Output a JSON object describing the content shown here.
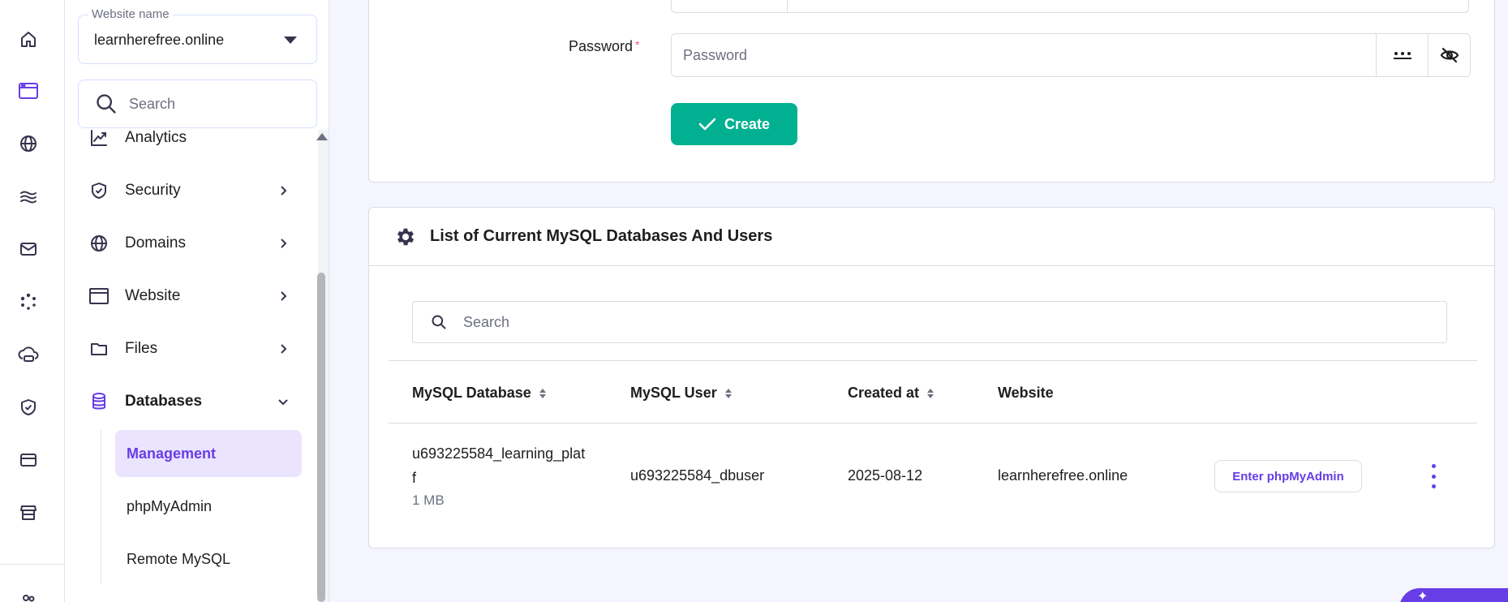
{
  "sidebar": {
    "website_select": {
      "legend": "Website name",
      "value": "learnherefree.online"
    },
    "search": {
      "placeholder": "Search"
    },
    "items": [
      {
        "label": "Analytics",
        "icon": "chart-icon"
      },
      {
        "label": "Security",
        "icon": "shield-icon"
      },
      {
        "label": "Domains",
        "icon": "globe-icon"
      },
      {
        "label": "Website",
        "icon": "browser-window-icon"
      },
      {
        "label": "Files",
        "icon": "folder-icon"
      },
      {
        "label": "Databases",
        "icon": "database-icon"
      }
    ],
    "database_subitems": [
      {
        "label": "Management",
        "active": true
      },
      {
        "label": "phpMyAdmin",
        "active": false
      },
      {
        "label": "Remote MySQL",
        "active": false
      }
    ]
  },
  "form": {
    "password_label": "Password",
    "required_marker": "*",
    "password_placeholder": "Password",
    "create_label": "Create"
  },
  "databases": {
    "title": "List of Current MySQL Databases And Users",
    "search_placeholder": "Search",
    "columns": [
      "MySQL Database",
      "MySQL User",
      "Created at",
      "Website"
    ],
    "rows": [
      {
        "database": "u693225584_learning_platf",
        "size": "1 MB",
        "user": "u693225584_dbuser",
        "created_at": "2025-08-12",
        "website": "learnherefree.online",
        "action_label": "Enter phpMyAdmin"
      }
    ]
  },
  "colors": {
    "accent": "#673de6",
    "success": "#00b090",
    "active_bg": "#ebe4ff",
    "page_bg": "#f4f5ff"
  }
}
